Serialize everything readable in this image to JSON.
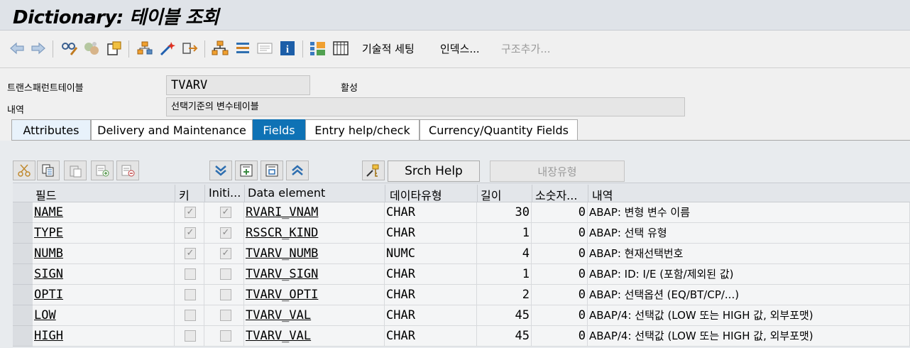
{
  "window": {
    "title": "Dictionary: 테이블 조회"
  },
  "toolbar": {
    "icons": [
      "back-icon",
      "forward-icon",
      "display-change-icon",
      "other-object-icon",
      "copy-object-icon",
      "where-used-icon",
      "test-icon",
      "activate-icon",
      "hierarchy-icon",
      "stack-icon",
      "text-doc-icon",
      "info-icon",
      "layout-icon",
      "table-icon"
    ],
    "tech_settings": "기술적 세팅",
    "indexes": "인덱스...",
    "append_structure": "구조추가..."
  },
  "header": {
    "transparent_table_label": "트랜스패런트테이블",
    "table_name": "TVARV",
    "status": "활성",
    "description_label": "내역",
    "description": "선택기준의 변수테이블"
  },
  "tabs": [
    "Attributes",
    "Delivery and Maintenance",
    "Fields",
    "Entry help/check",
    "Currency/Quantity Fields"
  ],
  "active_tab": "Fields",
  "grid_toolbar": {
    "icons": [
      "cut-icon",
      "copy-icon",
      "paste-icon",
      "insert-row-icon",
      "delete-row-icon",
      "expand-icon",
      "insert-include-icon",
      "include-icon",
      "collapse-icon",
      "search-help-icon"
    ],
    "srch_help": "Srch Help",
    "builtin_type": "내장유형"
  },
  "columns": [
    "필드",
    "키",
    "Initi...",
    "Data element",
    "데이타유형",
    "길이",
    "소숫자...",
    "내역"
  ],
  "rows": [
    {
      "field": "NAME",
      "key": true,
      "init": true,
      "data_element": "RVARI_VNAM",
      "type": "CHAR",
      "length": "30",
      "decimals": "0",
      "desc": "ABAP: 변형 변수 이름"
    },
    {
      "field": "TYPE",
      "key": true,
      "init": true,
      "data_element": "RSSCR_KIND",
      "type": "CHAR",
      "length": "1",
      "decimals": "0",
      "desc": "ABAP: 선택 유형"
    },
    {
      "field": "NUMB",
      "key": true,
      "init": true,
      "data_element": "TVARV_NUMB",
      "type": "NUMC",
      "length": "4",
      "decimals": "0",
      "desc": "ABAP: 현재선택번호"
    },
    {
      "field": "SIGN",
      "key": false,
      "init": false,
      "data_element": "TVARV_SIGN",
      "type": "CHAR",
      "length": "1",
      "decimals": "0",
      "desc": "ABAP: ID: I/E (포함/제외된 값)"
    },
    {
      "field": "OPTI",
      "key": false,
      "init": false,
      "data_element": "TVARV_OPTI",
      "type": "CHAR",
      "length": "2",
      "decimals": "0",
      "desc": "ABAP: 선택옵션 (EQ/BT/CP/...)"
    },
    {
      "field": "LOW",
      "key": false,
      "init": false,
      "data_element": "TVARV_VAL",
      "type": "CHAR",
      "length": "45",
      "decimals": "0",
      "desc": "ABAP/4: 선택값 (LOW 또는 HIGH 값, 외부포맷)"
    },
    {
      "field": "HIGH",
      "key": false,
      "init": false,
      "data_element": "TVARV_VAL",
      "type": "CHAR",
      "length": "45",
      "decimals": "0",
      "desc": "ABAP/4: 선택값 (LOW 또는 HIGH 값, 외부포맷)"
    }
  ],
  "colors": {
    "active_tab": "#0e72b5",
    "title_bar": "#dfe3e8",
    "panel": "#e8ebee"
  }
}
